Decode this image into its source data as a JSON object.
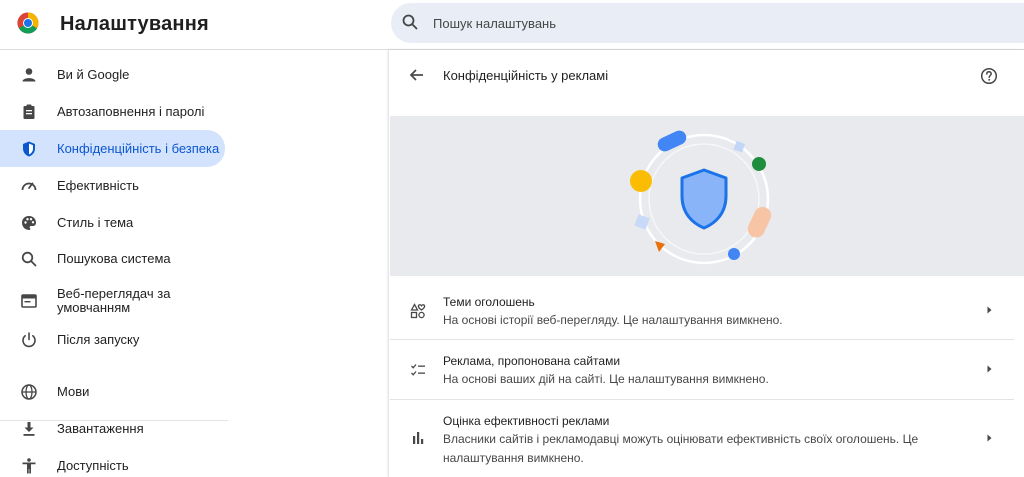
{
  "app": {
    "title": "Налаштування"
  },
  "search": {
    "placeholder": "Пошук налаштувань"
  },
  "sidebar": {
    "items": [
      {
        "label": "Ви й Google",
        "icon": "person-icon"
      },
      {
        "label": "Автозаповнення і паролі",
        "icon": "clipboard-icon"
      },
      {
        "label": "Конфіденційність і безпека",
        "icon": "shield-icon",
        "active": true
      },
      {
        "label": "Ефективність",
        "icon": "speedometer-icon"
      },
      {
        "label": "Стиль і тема",
        "icon": "palette-icon"
      },
      {
        "label": "Пошукова система",
        "icon": "search-icon"
      },
      {
        "label": "Веб-переглядач за умовчанням",
        "icon": "browser-window-icon"
      },
      {
        "label": "Після запуску",
        "icon": "power-icon"
      },
      {
        "label": "Мови",
        "icon": "globe-icon"
      },
      {
        "label": "Завантаження",
        "icon": "download-icon"
      },
      {
        "label": "Доступність",
        "icon": "accessibility-icon"
      }
    ]
  },
  "main": {
    "title": "Конфіденційність у рекламі",
    "rows": [
      {
        "title": "Теми оголошень",
        "subtitle": "На основі історії веб-перегляду. Це налаштування вимкнено.",
        "icon": "ad-topics-icon"
      },
      {
        "title": "Реклама, пропонована сайтами",
        "subtitle": "На основі ваших дій на сайті. Це налаштування вимкнено.",
        "icon": "checklist-icon"
      },
      {
        "title": "Оцінка ефективності реклами",
        "subtitle": "Власники сайтів і рекламодавці можуть оцінювати ефективність своїх оголошень. Це налаштування вимкнено.",
        "icon": "bar-chart-icon"
      }
    ]
  },
  "colors": {
    "accent": "#0b57d0",
    "active_bg": "#d3e3fd",
    "banner_bg": "#e8eaed"
  }
}
